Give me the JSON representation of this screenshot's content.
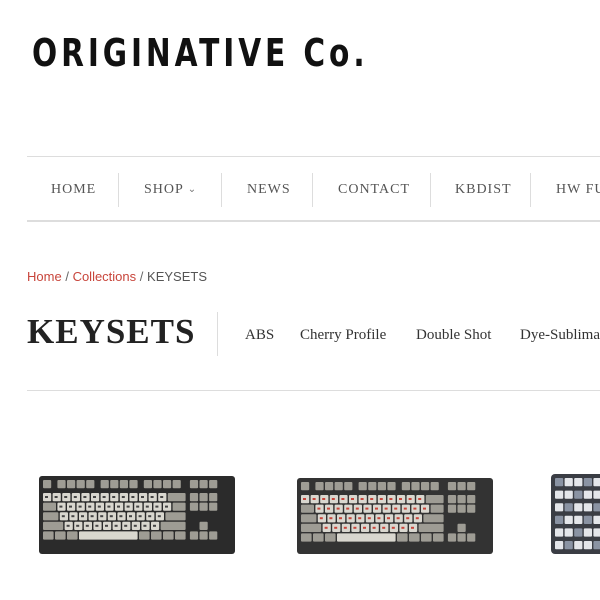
{
  "header": {
    "logo_text": "ORIGINATIVE Co."
  },
  "nav": {
    "items": [
      {
        "label": "HOME"
      },
      {
        "label": "SHOP",
        "has_dropdown": true,
        "icon": "chevron-down-icon"
      },
      {
        "label": "NEWS"
      },
      {
        "label": "CONTACT"
      },
      {
        "label": "KBDIST"
      },
      {
        "label": "HW FU"
      }
    ]
  },
  "breadcrumb": {
    "home": "Home",
    "separator": "/",
    "collections": "Collections",
    "current": "KEYSETS"
  },
  "page": {
    "title": "KEYSETS"
  },
  "filters": [
    {
      "label": "ABS"
    },
    {
      "label": "Cherry Profile"
    },
    {
      "label": "Double Shot"
    },
    {
      "label": "Dye-Sublima"
    }
  ],
  "colors": {
    "accent_link": "#c8453b",
    "divider": "#dddddd",
    "keyboard_case": "#2b2b2b",
    "key_beige": "#d9d7cf",
    "key_gray": "#9e9c94",
    "key_blue_gray": "#8a93a3"
  },
  "products": [
    {
      "image": "tkl-keyboard-beige-gray-keyset"
    },
    {
      "image": "tkl-keyboard-beige-red-legend-keyset"
    },
    {
      "image": "keyboard-blue-gray-keyset"
    }
  ]
}
